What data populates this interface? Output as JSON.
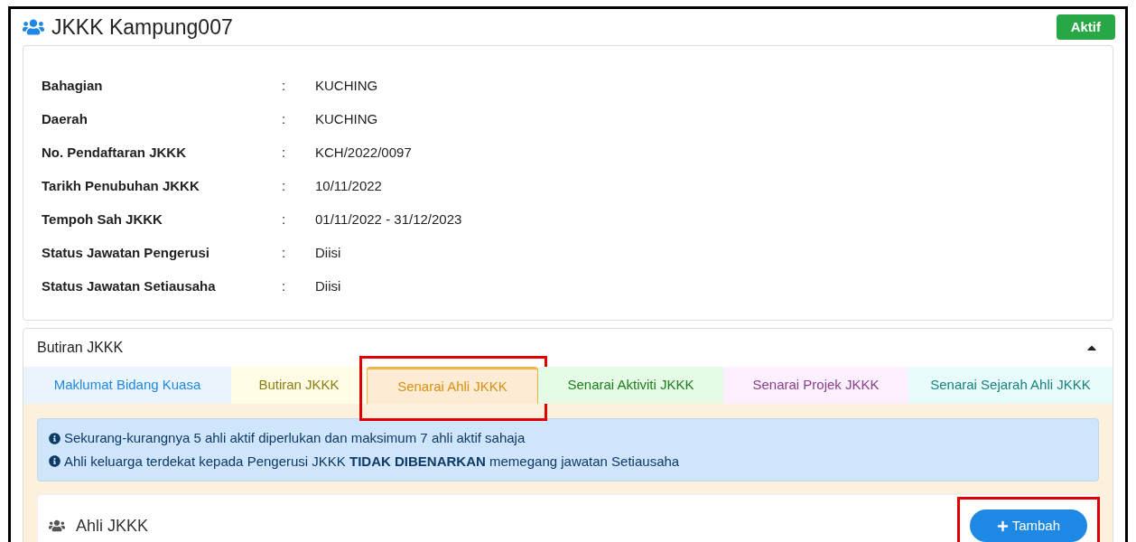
{
  "header": {
    "title": "JKKK Kampung007",
    "status": "Aktif"
  },
  "details": [
    {
      "label": "Bahagian",
      "separator": ":",
      "value": "KUCHING"
    },
    {
      "label": "Daerah",
      "separator": ":",
      "value": "KUCHING"
    },
    {
      "label": "No. Pendaftaran JKKK",
      "separator": ":",
      "value": "KCH/2022/0097"
    },
    {
      "label": "Tarikh Penubuhan JKKK",
      "separator": ":",
      "value": "10/11/2022"
    },
    {
      "label": "Tempoh Sah JKKK",
      "separator": ":",
      "value": "01/11/2022 - 31/12/2023"
    },
    {
      "label": "Status Jawatan Pengerusi",
      "separator": ":",
      "value": "Diisi"
    },
    {
      "label": "Status Jawatan Setiausaha",
      "separator": ":",
      "value": "Diisi"
    }
  ],
  "section": {
    "title": "Butiran JKKK",
    "expanded": true
  },
  "tabs": [
    {
      "label": "Maklumat Bidang Kuasa",
      "selected": false,
      "highlighted": false,
      "color": "#1e88e5"
    },
    {
      "label": "Butiran JKKK",
      "selected": false,
      "highlighted": false,
      "color": "#8a7d10"
    },
    {
      "label": "Senarai Ahli JKKK",
      "selected": true,
      "highlighted": true,
      "color": "#d9900f"
    },
    {
      "label": "Senarai Aktiviti JKKK",
      "selected": false,
      "highlighted": false,
      "color": "#1b7d1b"
    },
    {
      "label": "Senarai Projek JKKK",
      "selected": false,
      "highlighted": false,
      "color": "#8a3f8a"
    },
    {
      "label": "Senarai Sejarah Ahli JKKK",
      "selected": false,
      "highlighted": false,
      "color": "#1a7f7f"
    }
  ],
  "notices": [
    "Sekurang-kurangnya 5 ahli aktif diperlukan dan maksimum 7 ahli aktif sahaja",
    "Ahli keluarga terdekat kepada Pengerusi JKKK **TIDAK DIBENARKAN** memegang jawatan Setiausaha"
  ],
  "members_card": {
    "title": "Ahli JKKK",
    "add_button": {
      "label": "Tambah",
      "highlighted": true
    }
  }
}
